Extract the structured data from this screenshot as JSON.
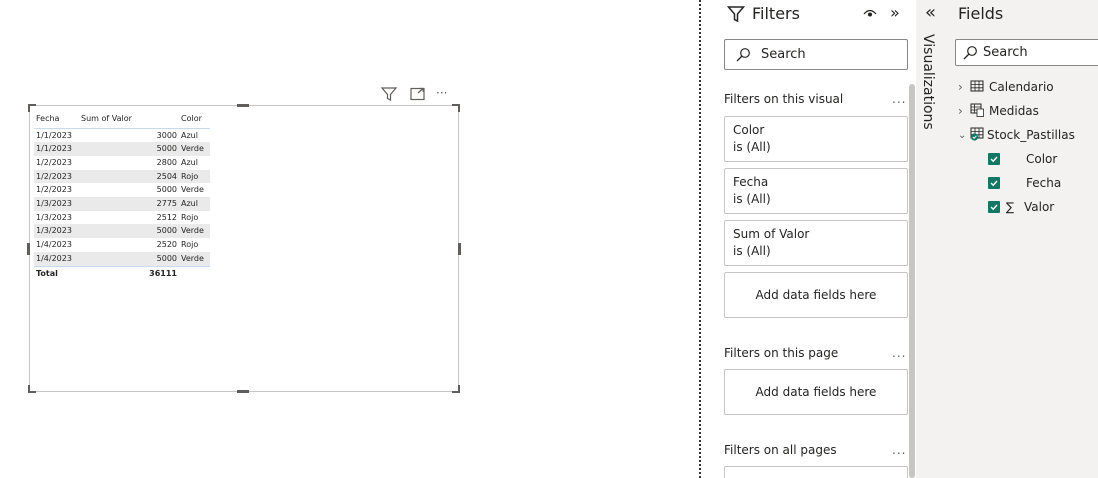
{
  "table_visual": {
    "columns": [
      "Fecha",
      "Sum of Valor",
      "Color"
    ],
    "rows": [
      {
        "fecha": "1/1/2023",
        "valor": "3000",
        "color": "Azul"
      },
      {
        "fecha": "1/1/2023",
        "valor": "5000",
        "color": "Verde"
      },
      {
        "fecha": "1/2/2023",
        "valor": "2800",
        "color": "Azul"
      },
      {
        "fecha": "1/2/2023",
        "valor": "2504",
        "color": "Rojo"
      },
      {
        "fecha": "1/2/2023",
        "valor": "5000",
        "color": "Verde"
      },
      {
        "fecha": "1/3/2023",
        "valor": "2775",
        "color": "Azul"
      },
      {
        "fecha": "1/3/2023",
        "valor": "2512",
        "color": "Rojo"
      },
      {
        "fecha": "1/3/2023",
        "valor": "5000",
        "color": "Verde"
      },
      {
        "fecha": "1/4/2023",
        "valor": "2520",
        "color": "Rojo"
      },
      {
        "fecha": "1/4/2023",
        "valor": "5000",
        "color": "Verde"
      }
    ],
    "total_label": "Total",
    "total_value": "36111"
  },
  "visual_header": {
    "icons": [
      "filter-icon",
      "focus-mode-icon",
      "more-options-icon"
    ],
    "more_label": "···"
  },
  "filters_pane": {
    "title": "Filters",
    "search_placeholder": "Search",
    "visual_section": "Filters on this visual",
    "page_section": "Filters on this page",
    "all_pages_section": "Filters on all pages",
    "more_label": "...",
    "cards": [
      {
        "name": "Color",
        "state": "is (All)"
      },
      {
        "name": "Fecha",
        "state": "is (All)"
      },
      {
        "name": "Sum of Valor",
        "state": "is (All)"
      }
    ],
    "add_fields_visual": "Add data fields here",
    "add_fields_page": "Add data fields here"
  },
  "visualizations_pane": {
    "label": "Visualizations",
    "collapse_glyph": "«"
  },
  "fields_pane": {
    "title": "Fields",
    "search_placeholder": "Search",
    "tables": [
      {
        "name": "Calendario",
        "expanded": false
      },
      {
        "name": "Medidas",
        "expanded": false
      },
      {
        "name": "Stock_Pastillas",
        "expanded": true,
        "fields": [
          {
            "name": "Color",
            "checked": true,
            "sigma": false
          },
          {
            "name": "Fecha",
            "checked": true,
            "sigma": false
          },
          {
            "name": "Valor",
            "checked": true,
            "sigma": true
          }
        ]
      }
    ],
    "sigma_glyph": "∑"
  },
  "colors": {
    "accent_check": "#117865",
    "pane_bg": "#f3f2f1",
    "border": "#c8c6c4",
    "header_line": "#c6dbf2"
  }
}
